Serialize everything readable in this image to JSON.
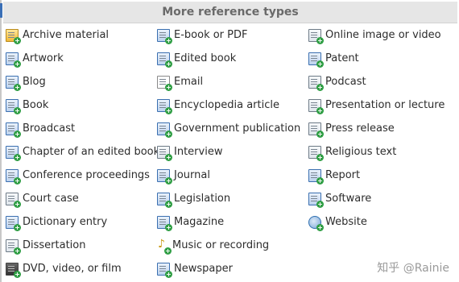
{
  "header": {
    "title": "More reference types"
  },
  "columns": [
    {
      "items": [
        {
          "label": "Archive material",
          "icon": "archive-icon"
        },
        {
          "label": "Artwork",
          "icon": "artwork-icon"
        },
        {
          "label": "Blog",
          "icon": "blog-icon"
        },
        {
          "label": "Book",
          "icon": "book-icon"
        },
        {
          "label": "Broadcast",
          "icon": "broadcast-icon"
        },
        {
          "label": "Chapter of an edited book",
          "icon": "chapter-icon"
        },
        {
          "label": "Conference proceedings",
          "icon": "conference-icon"
        },
        {
          "label": "Court case",
          "icon": "gavel-icon"
        },
        {
          "label": "Dictionary entry",
          "icon": "dictionary-icon"
        },
        {
          "label": "Dissertation",
          "icon": "dissertation-icon"
        },
        {
          "label": "DVD, video, or film",
          "icon": "film-icon"
        }
      ]
    },
    {
      "items": [
        {
          "label": "E-book or PDF",
          "icon": "ebook-icon"
        },
        {
          "label": "Edited book",
          "icon": "edited-book-icon"
        },
        {
          "label": "Email",
          "icon": "email-icon"
        },
        {
          "label": "Encyclopedia article",
          "icon": "encyclopedia-icon"
        },
        {
          "label": "Government publication",
          "icon": "government-icon"
        },
        {
          "label": "Interview",
          "icon": "interview-icon"
        },
        {
          "label": "Journal",
          "icon": "journal-icon"
        },
        {
          "label": "Legislation",
          "icon": "legislation-icon"
        },
        {
          "label": "Magazine",
          "icon": "magazine-icon"
        },
        {
          "label": "Music or recording",
          "icon": "music-icon"
        },
        {
          "label": "Newspaper",
          "icon": "newspaper-icon"
        }
      ]
    },
    {
      "items": [
        {
          "label": "Online image or video",
          "icon": "online-image-icon"
        },
        {
          "label": "Patent",
          "icon": "patent-icon"
        },
        {
          "label": "Podcast",
          "icon": "podcast-icon"
        },
        {
          "label": "Presentation or lecture",
          "icon": "presentation-icon"
        },
        {
          "label": "Press release",
          "icon": "press-release-icon"
        },
        {
          "label": "Religious text",
          "icon": "religious-text-icon"
        },
        {
          "label": "Report",
          "icon": "report-icon"
        },
        {
          "label": "Software",
          "icon": "software-icon"
        },
        {
          "label": "Website",
          "icon": "globe-icon"
        }
      ]
    }
  ],
  "watermark": "知乎 @Rainie",
  "colors": {
    "accent": "#2f9e44",
    "header_bg": "#e6e6e6",
    "text": "#2c2c2c"
  }
}
